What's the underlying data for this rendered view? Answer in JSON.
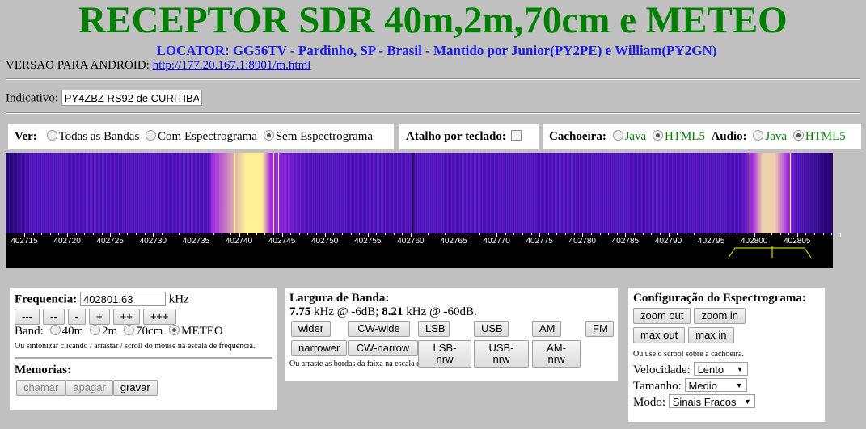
{
  "header": {
    "title": "RECEPTOR SDR 40m,2m,70cm e METEO",
    "locator": "LOCATOR: GG56TV - Pardinho, SP - Brasil - Mantido por Junior(PY2PE) e William(PY2GN)",
    "version_label": "VERSAO PARA ANDROID: ",
    "version_link": "http://177.20.167.1:8901/m.html "
  },
  "indicativo": {
    "label": "Indicativo: ",
    "value": "PY4ZBZ RS92 de CURITIBA"
  },
  "ver": {
    "label": "Ver:",
    "options": [
      "Todas as Bandas",
      "Com Espectrograma",
      "Sem Espectrograma"
    ],
    "selected": 2
  },
  "atalho": {
    "label": "Atalho por teclado:",
    "checked": false
  },
  "cachoeira": {
    "label": "Cachoeira:",
    "options": [
      "Java",
      "HTML5"
    ],
    "selected": 1
  },
  "audio": {
    "label": "Audio:",
    "options": [
      "Java",
      "HTML5"
    ],
    "selected": 1
  },
  "scale": {
    "labels": [
      "402715",
      "402720",
      "402725",
      "402730",
      "402735",
      "402740",
      "402745",
      "402750",
      "402755",
      "402760",
      "402765",
      "402770",
      "402775",
      "402780",
      "402785",
      "402790",
      "402795",
      "402800",
      "402805"
    ]
  },
  "frequencia": {
    "label": "Frequencia:",
    "value": "402801.63",
    "unit": "kHz",
    "steps": [
      "---",
      "--",
      "-",
      "+",
      "++",
      "+++"
    ],
    "band_label": "Band:",
    "bands": [
      "40m",
      "2m",
      "70cm",
      "METEO"
    ],
    "band_selected": 3,
    "hint": "Ou sintonizar clicando / arrastar / scroll do mouse na escala de frequencia.",
    "memorias_label": "Memorias:",
    "mem_buttons": [
      "chamar",
      "apagar",
      "gravar"
    ]
  },
  "largura": {
    "label": "Largura de Banda:",
    "bw6": "7.75",
    "bw6_text": " kHz @ -6dB; ",
    "bw60": "8.21",
    "bw60_text": " kHz @ -60dB.",
    "row1": [
      "wider",
      "CW-wide",
      "LSB",
      "USB",
      "AM",
      "FM"
    ],
    "row2": [
      "narrower",
      "CW-narrow",
      "LSB-nrw",
      "USB-nrw",
      "AM-nrw"
    ],
    "hint": "Ou arraste as bordas da faixa na escala de frequencia."
  },
  "config": {
    "label": "Configuração do Espectrograma:",
    "buttons": [
      "zoom out",
      "zoom in",
      "max out",
      "max in"
    ],
    "hint": "Ou use o scrool sobre a cachoeira.",
    "velocidade_label": "Velocidade:",
    "velocidade": "Lento",
    "tamanho_label": "Tamanho:",
    "tamanho": "Medio",
    "modo_label": "Modo:",
    "modo": "Sinais Fracos"
  }
}
